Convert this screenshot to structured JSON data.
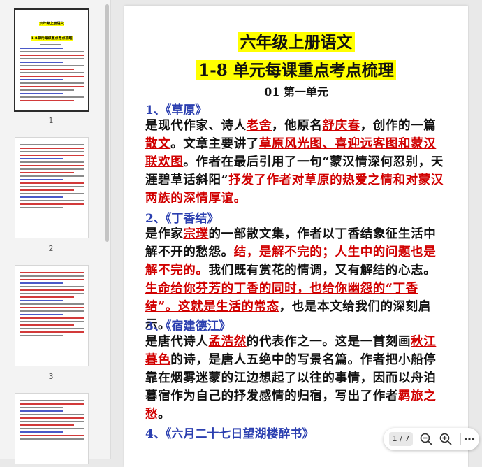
{
  "sidebar": {
    "thumbnails": [
      {
        "label": "1",
        "title1": "六年级上册语文",
        "title2": "1-8单元每课重点考点梳理"
      },
      {
        "label": "2"
      },
      {
        "label": "3"
      },
      {
        "label": ""
      }
    ]
  },
  "document": {
    "title_line1": "六年级上册语文",
    "title_line2": "1-8 单元每课重点考点梳理",
    "unit_heading": "01 第一单元",
    "sections": [
      {
        "heading": "1、《草原》"
      },
      {
        "heading": "2、《丁香结》"
      },
      {
        "heading": "3、《宿建德江》"
      },
      {
        "heading": "4、《六月二十七日望湖楼醉书》"
      }
    ],
    "p1": {
      "t1": "是现代作家、诗人",
      "r1": "老舍",
      "t2": "，他原名",
      "r2": "舒庆春",
      "t3": "，创作的一篇",
      "r3": "散文",
      "t4": "。文章主要讲了",
      "r4": "草原风光图、喜迎远客图和蒙汉联欢图",
      "t5": "。作者在最后引用了一句“蒙汉情深何忍别，天涯碧草话斜阳”",
      "r5": "抒发了作者对草原的热爱之情和对蒙汉两族的深情厚谊。"
    },
    "p2": {
      "t1": "是作家",
      "r1": "宗璞",
      "t2": "的一部散文集，作者以丁香结象征生活中解不开的愁怨。",
      "r2": "结，是解不完的；人生中的问题也是解不完的。",
      "t3": "我们既有赏花的情调，又有解结的心志。",
      "r3": "生命给你芬芳的丁香的同时，也给你幽怨的“丁香结”。这就是生活的常态",
      "t4": "，也是本文给我们的深刻启示。"
    },
    "p3": {
      "t1": "是唐代诗人",
      "r1": "孟浩然",
      "t2": "的代表作之一。这是一首刻画",
      "r2": "秋江暮色",
      "t3": "的诗，是唐人五绝中的写景名篇。作者把小船停靠在烟雾迷蒙的江边想起了以往的事情，因而以舟泊暮宿作为自己的抒发感情的归宿，写出了作者",
      "r3": "羁旅之愁",
      "t4": "。"
    }
  },
  "toolbar": {
    "page_indicator": "1 / 7",
    "zoom_out_icon": "zoom-out-icon",
    "zoom_in_icon": "zoom-in-icon",
    "more_icon": "more-icon"
  },
  "colors": {
    "highlight": "#ffff00",
    "heading_blue": "#2b3fb0",
    "key_red": "#d10000"
  }
}
